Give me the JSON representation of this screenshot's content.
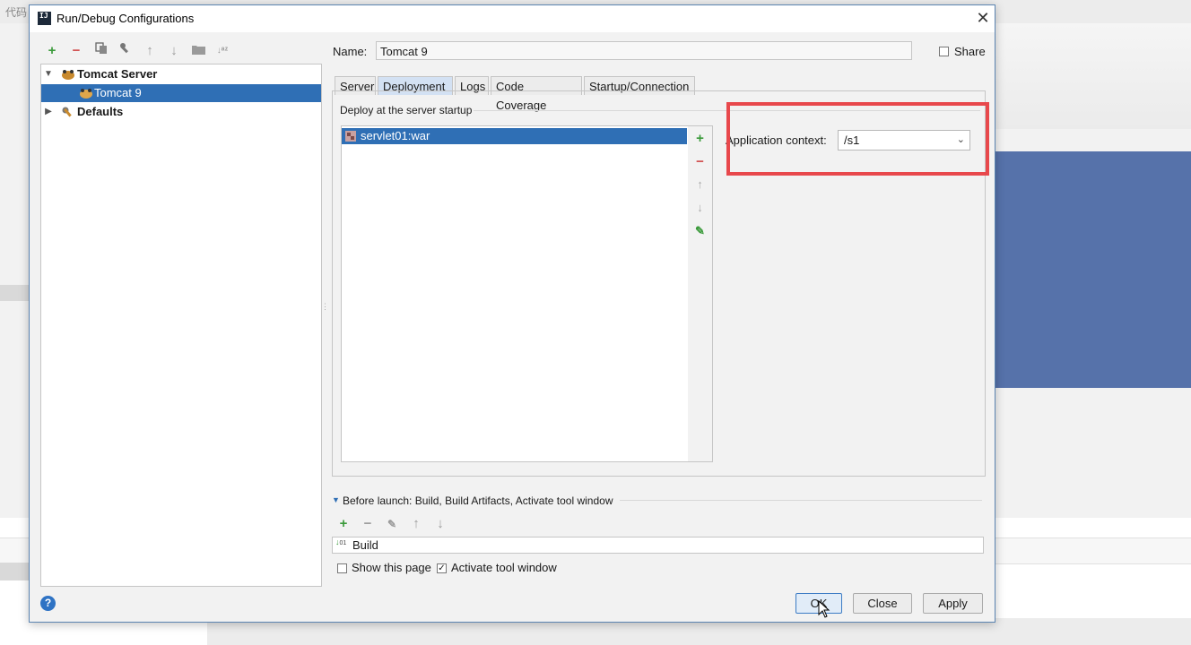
{
  "background": {
    "label": "代码"
  },
  "dialog": {
    "title": "Run/Debug Configurations",
    "app_icon_text": "IJ"
  },
  "toolbar": {
    "icons": [
      "add-icon",
      "remove-icon",
      "copy-icon",
      "wrench-icon",
      "move-up-icon",
      "move-down-icon",
      "folder-icon",
      "sort-icon"
    ]
  },
  "tree": {
    "items": [
      {
        "label": "Tomcat Server",
        "expanded": true
      },
      {
        "label": "Tomcat 9",
        "selected": true
      },
      {
        "label": "Defaults",
        "expanded": false
      }
    ]
  },
  "form": {
    "name_label": "Name:",
    "name_value": "Tomcat 9",
    "share_label": "Share",
    "share_checked": false
  },
  "tabs": [
    {
      "label": "Server"
    },
    {
      "label": "Deployment",
      "active": true
    },
    {
      "label": "Logs"
    },
    {
      "label": "Code Coverage"
    },
    {
      "label": "Startup/Connection"
    }
  ],
  "deployment": {
    "section_label": "Deploy at the server startup",
    "artifacts": [
      "servlet01:war"
    ],
    "app_context_label": "Application context:",
    "app_context_value": "/s1"
  },
  "before_launch": {
    "label": "Before launch: Build, Build Artifacts, Activate tool window",
    "tasks": [
      "Build"
    ],
    "show_page_label": "Show this page",
    "show_page_checked": false,
    "activate_label": "Activate tool window",
    "activate_checked": true
  },
  "buttons": {
    "ok": "OK",
    "close": "Close",
    "apply": "Apply"
  },
  "colors": {
    "selection": "#2f6fb5",
    "highlight": "#e8484c",
    "add_green": "#3a9a3a",
    "remove_red": "#d04b4b"
  }
}
